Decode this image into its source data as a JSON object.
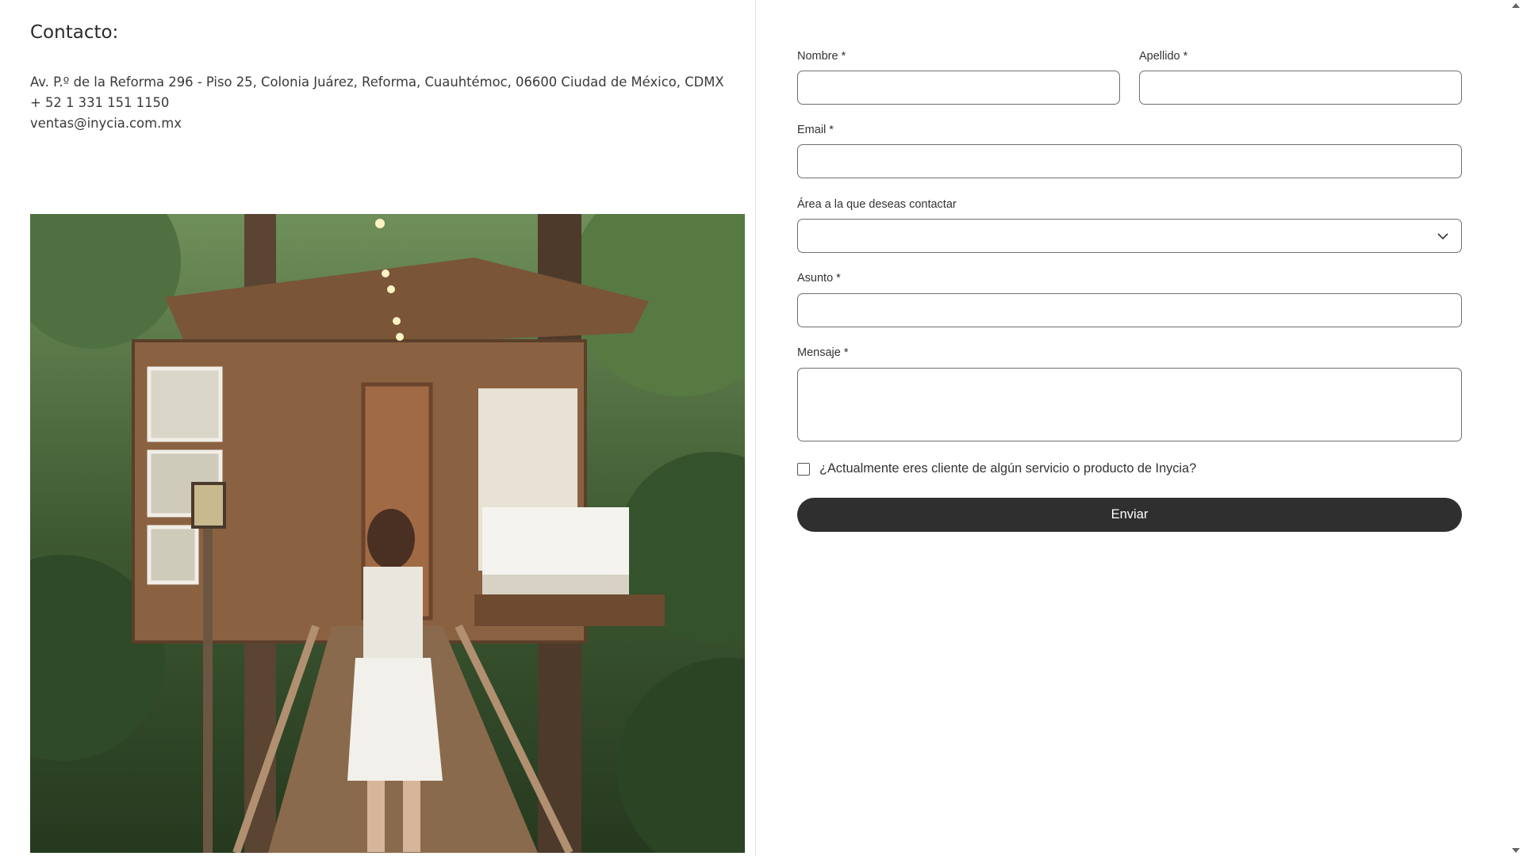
{
  "contact": {
    "title": "Contacto:",
    "address": "Av. P.º de la Reforma 296 - Piso 25, Colonia Juárez, Reforma, Cuauhtémoc, 06600 Ciudad de México, CDMX",
    "phone": "+ 52 1 331 151 1150",
    "email": "ventas@inycia.com.mx"
  },
  "form": {
    "nombre_label": "Nombre *",
    "apellido_label": "Apellido *",
    "email_label": "Email *",
    "area_label": "Área a la que deseas contactar",
    "asunto_label": "Asunto *",
    "mensaje_label": "Mensaje *",
    "checkbox_label": "¿Actualmente eres cliente de algún servicio o producto de Inycia?",
    "submit_label": "Enviar",
    "nombre_value": "",
    "apellido_value": "",
    "email_value": "",
    "area_value": "",
    "asunto_value": "",
    "mensaje_value": ""
  },
  "colors": {
    "button_bg": "#2f2f2f",
    "input_border": "#6f6f6f",
    "text": "#333333"
  },
  "icons": {
    "select_chevron": "chevron-down-icon",
    "scroll_up": "scroll-up-arrow-icon",
    "scroll_down": "scroll-down-arrow-icon"
  }
}
